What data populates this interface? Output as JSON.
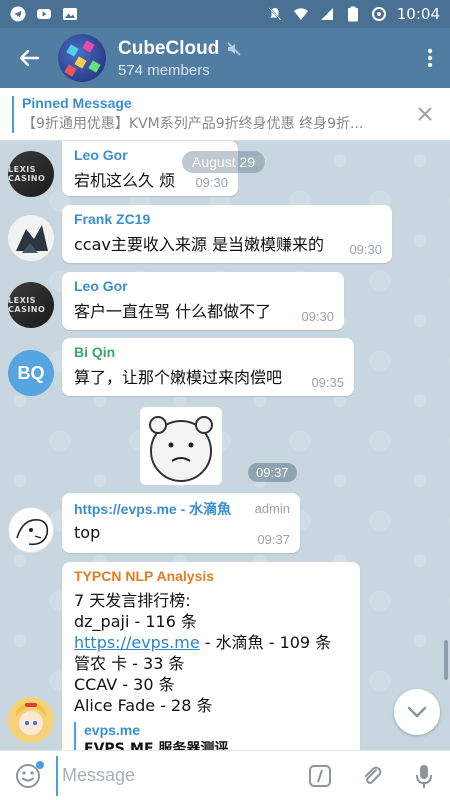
{
  "status_bar": {
    "time": "10:04"
  },
  "header": {
    "title": "CubeCloud",
    "members": "574 members",
    "muted_icon": "muted-speaker-icon"
  },
  "pinned": {
    "title": "Pinned Message",
    "body": "【9折通用优惠】KVM系列产品9折终身优惠 终身9折..."
  },
  "chat": {
    "date": "August 29",
    "messages": [
      {
        "sender": "Leo Gor",
        "sender_color": "#3a8fd0",
        "text": "宕机这么久 烦",
        "time": "09:30"
      },
      {
        "sender": "Frank ZC19",
        "sender_color": "#3a8fd0",
        "text": "ccav主要收入来源 是当嫩模赚来的",
        "time": "09:30"
      },
      {
        "sender": "Leo Gor",
        "sender_color": "#3a8fd0",
        "text": "客户一直在骂 什么都做不了",
        "time": "09:30"
      },
      {
        "sender": "Bi Qin",
        "sender_color": "#3aa86a",
        "avatar_initials": "BQ",
        "text": "算了，让那个嫩模过来肉偿吧",
        "time": "09:35"
      },
      {
        "sticker_time": "09:37"
      },
      {
        "sender": "https://evps.me - 水滴魚",
        "sender_color": "#3a8fd0",
        "badge": "admin",
        "text": "top",
        "time": "09:37"
      },
      {
        "sender": "TYPCN NLP Analysis",
        "sender_color": "#e07d22",
        "heading": "7 天发言排行榜:",
        "lines": [
          "dz_paji  - 116 条",
          "https://evps.me",
          " - 水滴魚 - 109 条",
          "管农 卡 - 33 条",
          "CCAV  - 30 条",
          "Alice Fade - 28 条"
        ],
        "quote_title": "evps.me",
        "quote_body": "EVPS.ME 服务器测评"
      }
    ]
  },
  "input": {
    "placeholder": "Message"
  },
  "colors": {
    "header": "#527da3",
    "statusbar": "#4a7094",
    "accent": "#4c9ce2"
  }
}
